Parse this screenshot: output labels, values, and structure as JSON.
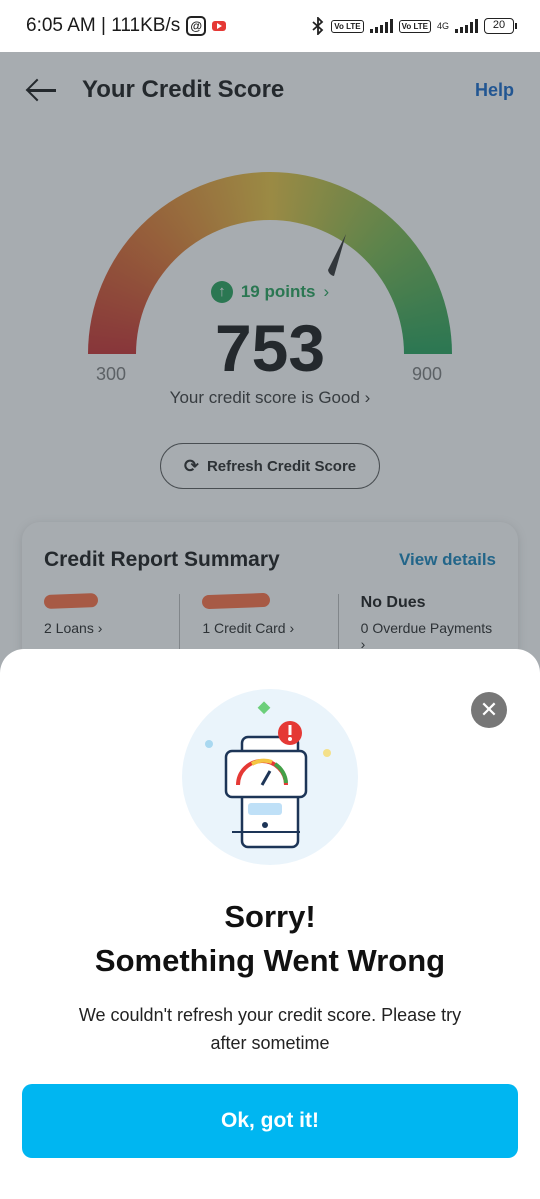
{
  "status_bar": {
    "time_speed": "6:05 AM | 111KB/s",
    "network_1": "Vo LTE",
    "network_2": "Vo LTE",
    "network_type": "4G",
    "battery": "20"
  },
  "header": {
    "title": "Your Credit Score",
    "help_label": "Help"
  },
  "gauge": {
    "min": "300",
    "max": "900",
    "score": "753",
    "score_value": 753,
    "points_change": "19 points",
    "caption": "Your credit score is Good",
    "colors": [
      "#c62828",
      "#e9c13b",
      "#1e9e55"
    ]
  },
  "refresh_button": {
    "label": "Refresh Credit Score",
    "icon": "refresh-icon"
  },
  "credit_summary": {
    "title": "Credit Report Summary",
    "view_details": "View details",
    "columns": [
      {
        "value": "",
        "sub": "2 Loans"
      },
      {
        "value": "",
        "sub": "1 Credit Card"
      },
      {
        "value": "No Dues",
        "sub": "0 Overdue Payments"
      }
    ]
  },
  "error_sheet": {
    "title_line1": "Sorry!",
    "title_line2": "Something Went Wrong",
    "message": "We couldn't refresh your credit score. Please try after sometime",
    "ok_button": "Ok, got it!",
    "close_icon": "close-icon",
    "accent_color": "#00b6f1"
  }
}
